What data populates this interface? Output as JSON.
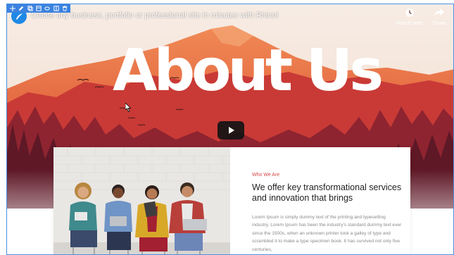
{
  "video": {
    "title": "Create any business, portfolio or professional site in minutes with Rhino!",
    "watch_later_label": "Watch later",
    "share_label": "Share"
  },
  "hero": {
    "title": "About Us"
  },
  "about": {
    "eyebrow": "Who We Are",
    "heading": "We offer key transformational services and innovation that brings",
    "body": "Lorem Ipsum is simply dummy text of the printing and typesetting industry. Lorem Ipsum has been the industry's standard dummy text ever since the 1500s, when an unknown printer took a galley of type and scrambled it to make a type specimen book. It has survived not only five centuries,"
  },
  "toolbar": {
    "icons": [
      "move-icon",
      "edit-icon",
      "duplicate-icon",
      "layout-icon",
      "link-icon",
      "columns-icon",
      "delete-icon"
    ]
  },
  "colors": {
    "accent_blue": "#3b82e0",
    "eyebrow_red": "#d64545",
    "mountain_orange": "#e8643c",
    "forest_red": "#b52e2e",
    "forest_dark": "#6e1d2a"
  }
}
